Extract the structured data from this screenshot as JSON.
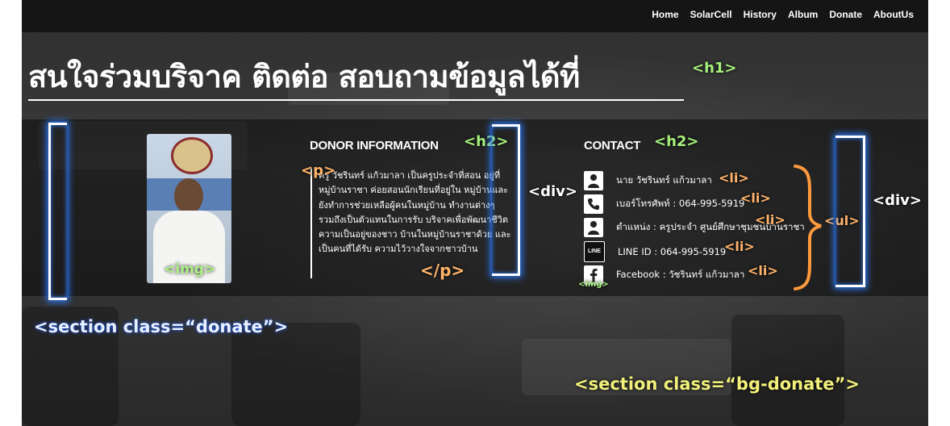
{
  "nav": {
    "items": [
      "Home",
      "SolarCell",
      "History",
      "Album",
      "Donate",
      "AboutUs"
    ]
  },
  "page": {
    "title": "สนใจร่วมบริจาค ติดต่อ สอบถามข้อมูลได้ที่"
  },
  "donor": {
    "title": "DONOR INFORMATION",
    "paragraph": "ครู วัชรินทร์ แก้วมาลา เป็นครูประจำที่สอน อยู่ที่หมู่บ้านราชา ค่อยสอนนักเรียนที่อยู่ใน หมู่บ้านและยังทำการช่วยเหลือผู้คนในหมู่บ้าน ทำงานต่างๆ รวมถึงเป็นตัวแทนในการรับ บริจาคเพื่อพัฒนาชีวิตความเป็นอยู่ของชาว บ้านในหมู่บ้านราชาด้วย และเป็นคนที่ได้รับ ความไว้วางใจจากชาวบ้าน"
  },
  "contact": {
    "title": "CONTACT",
    "items": [
      {
        "icon": "person-icon",
        "text": "นาย วัชรินทร์ แก้วมาลา"
      },
      {
        "icon": "phone-icon",
        "text": "เบอร์โทรศัพท์ : 064-995-5919"
      },
      {
        "icon": "person-icon",
        "text": "ตำแหน่ง : ครูประจำ ศูนย์ศึกษาชุมชนบ้านราชา"
      },
      {
        "icon": "line-icon",
        "text": "LINE ID : 064-995-5919",
        "badge": "LINE"
      },
      {
        "icon": "facebook-icon",
        "text": "Facebook : วัชรินทร์ แก้วมาลา"
      }
    ]
  },
  "annotations": {
    "h1": "<h1>",
    "h2_donor": "<h2>",
    "h2_contact": "<h2>",
    "p_open": "<p>",
    "p_close": "</p>",
    "div_left": "<div>",
    "div_right": "<div>",
    "img_photo": "<img>",
    "img_icon": "<img>",
    "li": "<li>",
    "ul": "<ul>",
    "section_donate": "<section class=“donate”>",
    "section_bg": "<section class=“bg-donate”>"
  },
  "colors": {
    "annotation_green": "#a6f07c",
    "annotation_orange": "#ffb36a",
    "annotation_yellow": "#f2f07a",
    "bracket_glow": "#2a7bff"
  }
}
